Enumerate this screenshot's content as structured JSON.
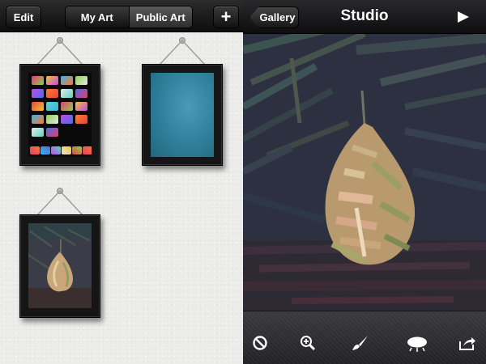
{
  "left_screen": {
    "toolbar": {
      "edit_label": "Edit",
      "segments": [
        {
          "label": "My Art",
          "active": false
        },
        {
          "label": "Public Art",
          "active": true
        }
      ],
      "add_label": "+"
    },
    "gallery_frames": [
      {
        "content": "color swatch grid"
      },
      {
        "content": "blue painting"
      },
      {
        "content": "pear painting"
      }
    ]
  },
  "right_screen": {
    "navbar": {
      "back_label": "Gallery",
      "title": "Studio",
      "play_icon": "play-icon"
    },
    "bottom_toolbar": {
      "tools": [
        "cancel-icon",
        "zoom-in-icon",
        "brush-icon",
        "brush-size-icon",
        "share-icon"
      ]
    }
  },
  "colors": {
    "wall": "#ececea",
    "toolbar_dark": "#111111",
    "frame_black": "#151515",
    "painting_blue": "#2f8aa6",
    "canvas_dark": "#2c2f3b",
    "pear": "#c9a77a"
  }
}
